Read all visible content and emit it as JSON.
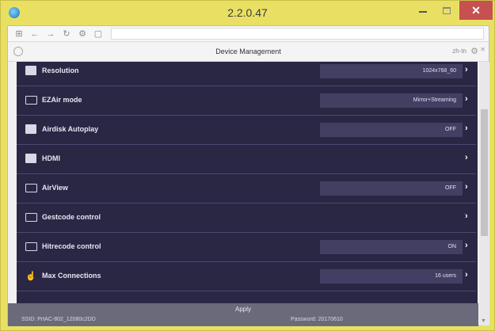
{
  "window": {
    "title": "2.2.0.47"
  },
  "header": {
    "title": "Device Management",
    "lang": "zh-tn"
  },
  "rows": [
    {
      "label": "Resolution",
      "value": "1024x768_60",
      "icon": "resolution-icon"
    },
    {
      "label": "EZAir mode",
      "value": "Mirror+Streaming",
      "icon": "ezair-icon"
    },
    {
      "label": "Airdisk Autoplay",
      "value": "OFF",
      "icon": "airdisk-icon"
    },
    {
      "label": "HDMI",
      "value": "",
      "icon": "hdmi-icon"
    },
    {
      "label": "AirView",
      "value": "OFF",
      "icon": "airview-icon"
    },
    {
      "label": "Gestcode control",
      "value": "",
      "icon": "gestcode-icon"
    },
    {
      "label": "Hitrecode control",
      "value": "ON",
      "icon": "hitrecode-icon"
    },
    {
      "label": "Max Connections",
      "value": "16 users",
      "icon": "connections-icon"
    }
  ],
  "footer": {
    "apply_label": "Apply",
    "ssid": "SSID: PrtAC-802_12080c2DD",
    "password": "Password: 20170610"
  }
}
